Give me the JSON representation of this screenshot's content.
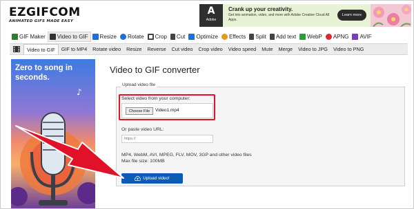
{
  "header": {
    "logo_main": "EZGIFCOM",
    "logo_sub": "ANIMATED GIFS MADE EASY"
  },
  "ad": {
    "brand": "Adobe",
    "title": "Crank up your creativity.",
    "subtitle": "Get into animation, video, and more with Adobe Creative Cloud All Apps.",
    "button": "Learn more"
  },
  "mainnav": [
    {
      "label": "GIF Maker",
      "icon": "gif-maker-icon",
      "color": "#2e7d32"
    },
    {
      "label": "Video to GIF",
      "icon": "video-icon",
      "color": "#333333"
    },
    {
      "label": "Resize",
      "icon": "resize-icon",
      "color": "#1e6fd9"
    },
    {
      "label": "Rotate",
      "icon": "rotate-icon",
      "color": "#1e6fd9"
    },
    {
      "label": "Crop",
      "icon": "crop-icon",
      "color": "#444444"
    },
    {
      "label": "Cut",
      "icon": "cut-icon",
      "color": "#444444"
    },
    {
      "label": "Optimize",
      "icon": "optimize-icon",
      "color": "#1e6fd9"
    },
    {
      "label": "Effects",
      "icon": "effects-icon",
      "color": "#e39a1e"
    },
    {
      "label": "Split",
      "icon": "split-icon",
      "color": "#444444"
    },
    {
      "label": "Add text",
      "icon": "add-text-icon",
      "color": "#444444"
    },
    {
      "label": "WebP",
      "icon": "webp-icon",
      "color": "#2e9c3c"
    },
    {
      "label": "APNG",
      "icon": "apng-icon",
      "color": "#d92b2b"
    },
    {
      "label": "AVIF",
      "icon": "avif-icon",
      "color": "#7a3fb8"
    }
  ],
  "subnav": [
    {
      "label": "Video to GIF"
    },
    {
      "label": "GIF to MP4"
    },
    {
      "label": "Rotate video"
    },
    {
      "label": "Resize"
    },
    {
      "label": "Reverse"
    },
    {
      "label": "Cut video"
    },
    {
      "label": "Crop video"
    },
    {
      "label": "Video speed"
    },
    {
      "label": "Mute"
    },
    {
      "label": "Merge"
    },
    {
      "label": "Video to JPG"
    },
    {
      "label": "Video to PNG"
    }
  ],
  "promo": {
    "title": "Zero to song in seconds."
  },
  "main": {
    "title": "Video to GIF converter",
    "legend": "Upload video file",
    "select_label": "Select video from your computer:",
    "choose_button": "Choose File",
    "file_name": "Video1.mp4",
    "url_label": "Or paste video URL:",
    "url_placeholder": "https://",
    "formats_text": "MP4, WebM, AVI, MPEG, FLV, MOV, 3GP and other video files",
    "max_size_text": "Max file size: 100MB",
    "upload_button": "Upload video!"
  },
  "colors": {
    "highlight": "#e0122a",
    "upload_button": "#0c5bb6"
  }
}
